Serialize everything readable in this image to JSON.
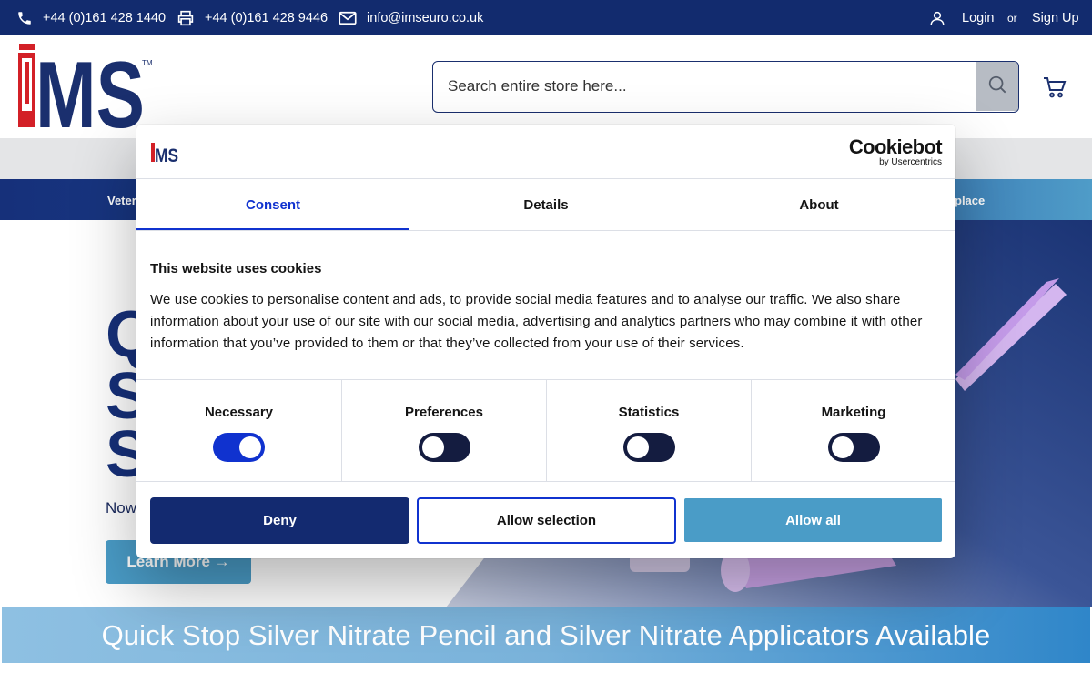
{
  "topbar": {
    "phone": "+44 (0)161 428 1440",
    "fax": "+44 (0)161 428 9446",
    "email": "info@imseuro.co.uk",
    "login": "Login",
    "or": "or",
    "signup": "Sign Up",
    "icons": [
      "phone-icon",
      "printer-icon",
      "mail-icon",
      "user-icon"
    ]
  },
  "header": {
    "logo_text": "iMS",
    "search_placeholder": "Search entire store here...",
    "icons": [
      "search-icon",
      "cart-icon"
    ]
  },
  "nav": {
    "left_fragment": "Veter",
    "right_fragment": "place"
  },
  "hero": {
    "heading_lines": [
      "Q",
      "S",
      "S"
    ],
    "subtext": "Now",
    "learn_more": "Learn More →"
  },
  "banner": {
    "text": "Quick Stop Silver Nitrate Pencil and Silver Nitrate Applicators Available"
  },
  "cookie_dialog": {
    "brand_small": "iMS",
    "cookiebot_title": "Cookiebot",
    "cookiebot_sub": "by Usercentrics",
    "tabs": [
      {
        "label": "Consent",
        "active": true
      },
      {
        "label": "Details",
        "active": false
      },
      {
        "label": "About",
        "active": false
      }
    ],
    "heading": "This website uses cookies",
    "body": "We use cookies to personalise content and ads, to provide social media features and to analyse our traffic. We also share information about your use of our site with our social media, advertising and analytics partners who may combine it with other information that you’ve provided to them or that they’ve collected from your use of their services.",
    "preferences": [
      {
        "label": "Necessary",
        "enabled": true
      },
      {
        "label": "Preferences",
        "enabled": false
      },
      {
        "label": "Statistics",
        "enabled": false
      },
      {
        "label": "Marketing",
        "enabled": false
      }
    ],
    "buttons": {
      "deny": "Deny",
      "allow_selection": "Allow selection",
      "allow_all": "Allow all"
    }
  },
  "colors": {
    "navy": "#122b6e",
    "accent_blue": "#1032cf",
    "teal": "#4a9cc7",
    "logo_red": "#d32027"
  }
}
